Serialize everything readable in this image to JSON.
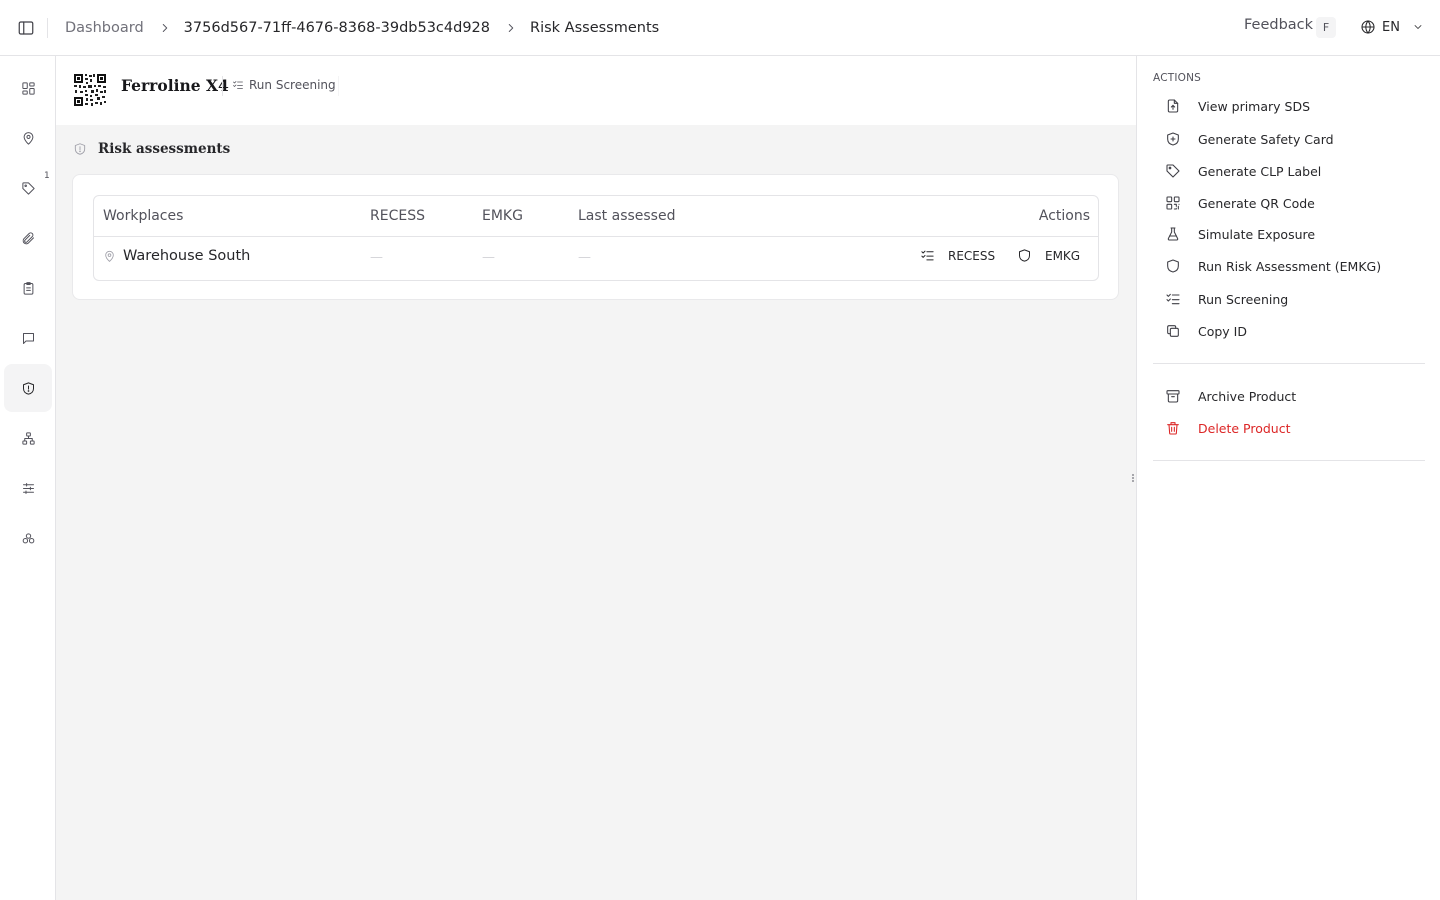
{
  "header": {
    "breadcrumbs": [
      "Dashboard",
      "3756d567-71ff-4676-8368-39db53c4d928",
      "Risk Assessments"
    ],
    "feedback_label": "Feedback",
    "feedback_shortcut": "F",
    "language": "EN"
  },
  "rail": {
    "items": [
      "overview-icon",
      "location-icon",
      "tag-icon",
      "paperclip-icon",
      "clipboard-icon",
      "message-icon",
      "shield-icon",
      "hierarchy-icon",
      "sliders-icon",
      "components-icon"
    ],
    "active": "shield-icon",
    "location_badge": "1"
  },
  "product": {
    "name": "Ferroline X4",
    "quick_action": "Run Screening"
  },
  "section": {
    "title": "Risk assessments"
  },
  "table": {
    "columns": [
      "Workplaces",
      "RECESS",
      "EMKG",
      "Last assessed",
      "Actions"
    ],
    "rows": [
      {
        "workplace": "Warehouse South",
        "recess": "—",
        "emkg": "—",
        "last_assessed": "—",
        "actions": [
          "RECESS",
          "EMKG"
        ]
      }
    ]
  },
  "actions_panel": {
    "heading": "ACTIONS",
    "items": [
      "View primary SDS",
      "Generate Safety Card",
      "Generate CLP Label",
      "Generate QR Code",
      "Simulate Exposure",
      "Run Risk Assessment (EMKG)",
      "Run Screening",
      "Copy ID"
    ],
    "secondary_items": [
      "Archive Product",
      "Delete Product"
    ]
  },
  "colors": {
    "danger": "#dc2626",
    "surface": "#f4f4f4",
    "border": "#e4e4e7",
    "muted_text": "#71717a"
  }
}
